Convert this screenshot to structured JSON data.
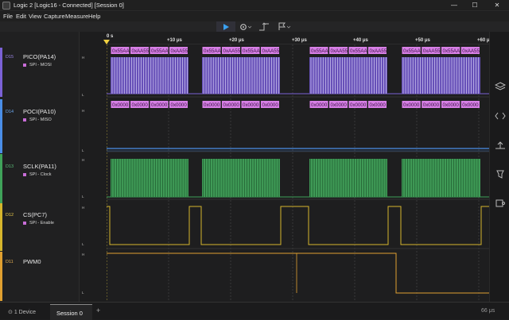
{
  "window": {
    "title": "Logic 2 [Logic16 - Connected] [Session 0]",
    "minimize": "—",
    "maximize": "☐",
    "close": "✕"
  },
  "menu": [
    "File",
    "Edit",
    "View",
    "Capture",
    "Measure",
    "Help"
  ],
  "toolbar": {
    "play_icon": "play-icon",
    "settings_icon": "gear-icon",
    "trigger_icon": "trigger-icon",
    "marker_icon": "flag-icon"
  },
  "timeline": {
    "labels": [
      "0 s",
      "+10 μs",
      "+20 μs",
      "+30 μs",
      "+40 μs",
      "+50 μs",
      "+60 μ"
    ],
    "trigger_marker": "T"
  },
  "channels": [
    {
      "id": "D15",
      "name": "PICO(PA14)",
      "analyzer": "SPI - MOSI",
      "color": "#7b61d6",
      "labels": [
        "0x55AA",
        "0xAA55",
        "0x55AA",
        "0xAA55"
      ]
    },
    {
      "id": "D14",
      "name": "POCI(PA10)",
      "analyzer": "SPI - MISO",
      "color": "#4a8ee8",
      "labels": [
        "0x0000",
        "0x0000",
        "0x0000",
        "0x0000"
      ]
    },
    {
      "id": "D13",
      "name": "SCLK(PA11)",
      "analyzer": "SPI - Clock",
      "color": "#3fa35a",
      "labels": []
    },
    {
      "id": "D12",
      "name": "CS(PC7)",
      "analyzer": "SPI - Enable",
      "color": "#d6b52c",
      "labels": []
    },
    {
      "id": "D11",
      "name": "PWM0",
      "analyzer": "",
      "color": "#e0a030",
      "labels": []
    }
  ],
  "levels": {
    "high": "H",
    "low": "L"
  },
  "status": {
    "devices": "1 Device",
    "session_tab": "Session 0",
    "add_tab": "+",
    "fps": "66 μs"
  },
  "right_sidebar_icons": [
    "layers-icon",
    "code-icon",
    "measure-icon",
    "marker-icon",
    "extension-icon"
  ]
}
